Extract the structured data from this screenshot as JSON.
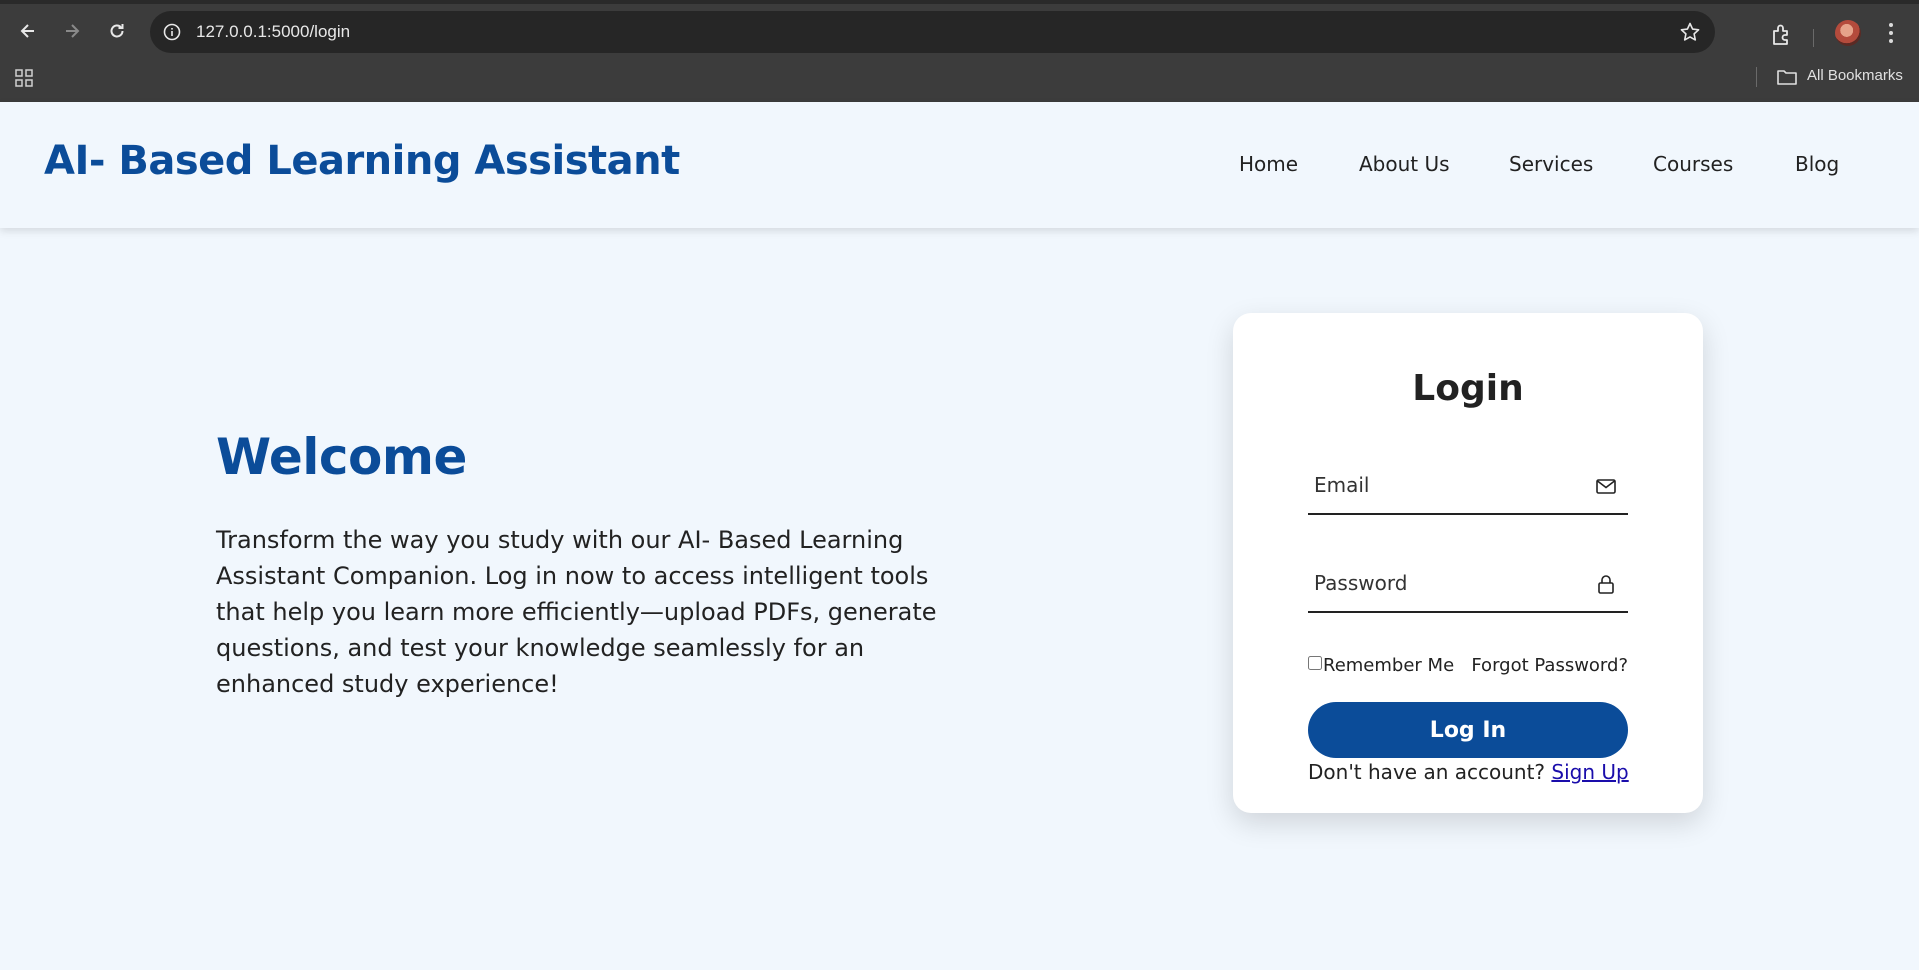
{
  "browser": {
    "url": "127.0.0.1:5000/login",
    "bookmarks_label": "All Bookmarks",
    "icons": [
      "back-icon",
      "forward-icon",
      "reload-icon",
      "info-icon",
      "star-icon",
      "extensions-icon",
      "profile-avatar",
      "more-menu-icon",
      "apps-grid-icon",
      "folder-icon"
    ]
  },
  "header": {
    "brand": "AI- Based Learning Assistant",
    "nav": [
      "Home",
      "About Us",
      "Services",
      "Courses",
      "Blog"
    ]
  },
  "hero": {
    "title": "Welcome",
    "text": "Transform the way you study with our AI- Based Learning Assistant Companion. Log in now to access intelligent tools that help you learn more efficiently—upload PDFs, generate questions, and test your knowledge seamlessly for an enhanced study experience!"
  },
  "login": {
    "title": "Login",
    "email_placeholder": "Email",
    "password_placeholder": "Password",
    "remember_label": "Remember Me",
    "forgot_label": "Forgot Password?",
    "button_label": "Log In",
    "signup_prompt": "Don't have an account?",
    "signup_link": "Sign Up"
  },
  "colors": {
    "brand_blue": "#0b4c99",
    "page_background": "#f1f7fd",
    "card_background": "#ffffff",
    "link_blue": "#1a0dab"
  }
}
